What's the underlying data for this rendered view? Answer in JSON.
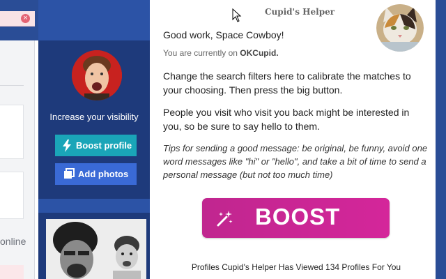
{
  "background_page": {
    "close_glyph": "×",
    "online_text": "online",
    "visibility_text": "Increase your visibility",
    "boost_profile_label": "Boost profile",
    "add_photos_label": "Add photos"
  },
  "panel": {
    "title": "Cupid's Helper",
    "greeting": "Good work, Space Cowboy!",
    "current_prefix": "You are currently on ",
    "current_site": "OKCupid.",
    "paragraph1": "Change the search filters here to calibrate the matches to your choosing. Then press the big button.",
    "paragraph2": "People you visit who visit you back might be interested in you, so be sure to say hello to them.",
    "tips": "Tips for sending a good message: be original, be funny, avoid one word messages like \"hi\" or \"hello\", and take a bit of time to send a personal message (but not too much time)",
    "boost_label": "BOOST",
    "footer": "Profiles Cupid's Helper Has Viewed 134 Profiles For You"
  },
  "colors": {
    "navy": "#1e3a7b",
    "teal_button": "#1aa5b8",
    "blue_button": "#3a6ad6",
    "boost_magenta": "#c8268f"
  },
  "icons": [
    "close-icon",
    "lightning-icon",
    "photos-icon",
    "magic-wand-icon",
    "mouse-cursor-icon"
  ]
}
